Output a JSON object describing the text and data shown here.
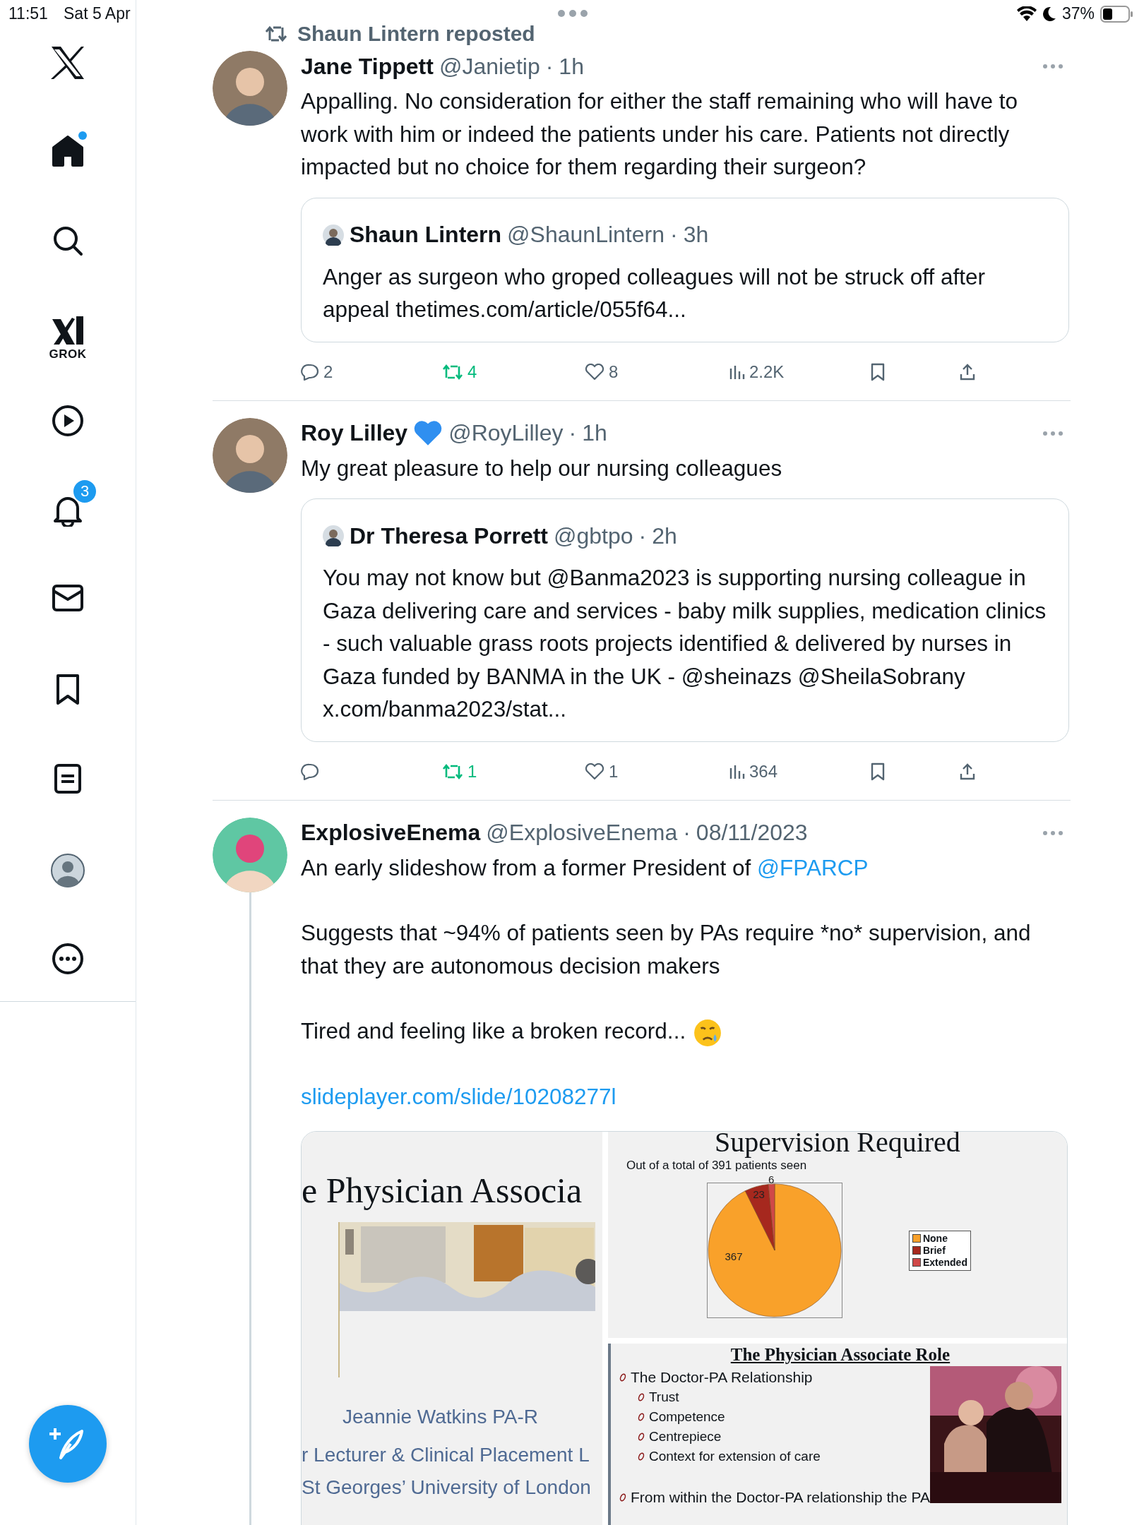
{
  "status_bar": {
    "time": "11:51",
    "date": "Sat 5 Apr",
    "battery": "37%"
  },
  "sidebar": {
    "items": [
      {
        "kind": "logo"
      },
      {
        "kind": "home",
        "selected": true,
        "unread": true
      },
      {
        "kind": "search",
        "selected": false
      },
      {
        "kind": "grok",
        "label": "GROK"
      },
      {
        "kind": "video",
        "selected": false
      },
      {
        "kind": "notifications",
        "selected": false,
        "badge": "3"
      },
      {
        "kind": "messages",
        "selected": false
      },
      {
        "kind": "bookmarks",
        "selected": false
      },
      {
        "kind": "lists",
        "selected": false
      },
      {
        "kind": "profile",
        "selected": false
      },
      {
        "kind": "more",
        "selected": false
      }
    ]
  },
  "feed": [
    {
      "repost_label": "Shaun Lintern reposted",
      "name": "Jane Tippett",
      "heart_badge": false,
      "handle": "@Janietip",
      "separator": "·",
      "time": "1h",
      "thread": false,
      "paragraphs": [
        {
          "segments": [
            {
              "text": "Appalling. No consideration for either the staff remaining who will have to work with him or indeed the patients under his care. Patients not directly impacted but no choice for them regarding their surgeon?",
              "link": false
            }
          ],
          "emoji": false
        }
      ],
      "quote": {
        "name": "Shaun Lintern",
        "handle": "@ShaunLintern",
        "separator": "·",
        "time": "3h",
        "text": "Anger as surgeon who groped colleagues will not be struck off after appeal thetimes.com/article/055f64..."
      },
      "actions": {
        "reply": "2",
        "repost": "4",
        "reposted": true,
        "like": "8",
        "liked": false,
        "views": "2.2K"
      }
    },
    {
      "name": "Roy Lilley",
      "heart_badge": true,
      "handle": "@RoyLilley",
      "separator": "·",
      "time": "1h",
      "thread": false,
      "paragraphs": [
        {
          "segments": [
            {
              "text": "My great pleasure to help our nursing colleagues",
              "link": false
            }
          ],
          "emoji": false
        }
      ],
      "quote": {
        "name": "Dr Theresa Porrett",
        "handle": "@gbtpo",
        "separator": "·",
        "time": "2h",
        "text": "You may not know but @Banma2023 is supporting nursing colleague in Gaza delivering care and services - baby milk supplies, medication clinics - such valuable grass roots projects identified & delivered by nurses in Gaza funded by BANMA in the UK - @sheinazs @SheilaSobrany x.com/banma2023/stat..."
      },
      "actions": {
        "repost": "1",
        "reposted": true,
        "like": "1",
        "liked": false,
        "views": "364"
      }
    },
    {
      "name": "ExplosiveEnema",
      "heart_badge": false,
      "handle": "@ExplosiveEnema",
      "separator": "·",
      "time": "08/11/2023",
      "thread": true,
      "paragraphs": [
        {
          "segments": [
            {
              "text": "An early slideshow from a former President of ",
              "link": false
            },
            {
              "text": "@FPARCP",
              "link": true
            }
          ],
          "emoji": false
        },
        {
          "segments": [
            {
              "text": "Suggests that ~94% of patients seen by PAs require *no* supervision, and that they are autonomous decision makers",
              "link": false
            }
          ],
          "emoji": false
        },
        {
          "segments": [
            {
              "text": "Tired and feeling like a broken record...",
              "link": false
            }
          ],
          "emoji": true
        },
        {
          "segments": [
            {
              "text": "slideplayer.com/slide/10208277l",
              "link": true
            }
          ],
          "emoji": false
        }
      ],
      "media": {
        "title_slide": {
          "title": "e Physician Associa",
          "kind": "picture",
          "lines": [
            "Jeannie Watkins PA-R",
            "r Lecturer & Clinical Placement L",
            "St Georges’ University of London"
          ]
        },
        "chart_slide": {
          "subtitle": "Out of a total of 391 patients seen",
          "chart_data": {
            "type": "pie",
            "title": "Supervision Required",
            "categories": [
              "None",
              "Brief",
              "Extended"
            ],
            "values": [
              367,
              23,
              6
            ],
            "data_labels": true,
            "legend": "right"
          }
        },
        "role_slide": {
          "title": "The Physician Associate Role",
          "items": [
            {
              "text": "The Doctor-PA Relationship",
              "children": [
                {
                  "text": "Trust"
                },
                {
                  "text": "Competence"
                },
                {
                  "text": "Centrepiece"
                },
                {
                  "text": "Context for extension of care"
                }
              ]
            },
            {
              "text": "From within the Doctor-PA relationship the PA"
            }
          ]
        }
      }
    }
  ]
}
